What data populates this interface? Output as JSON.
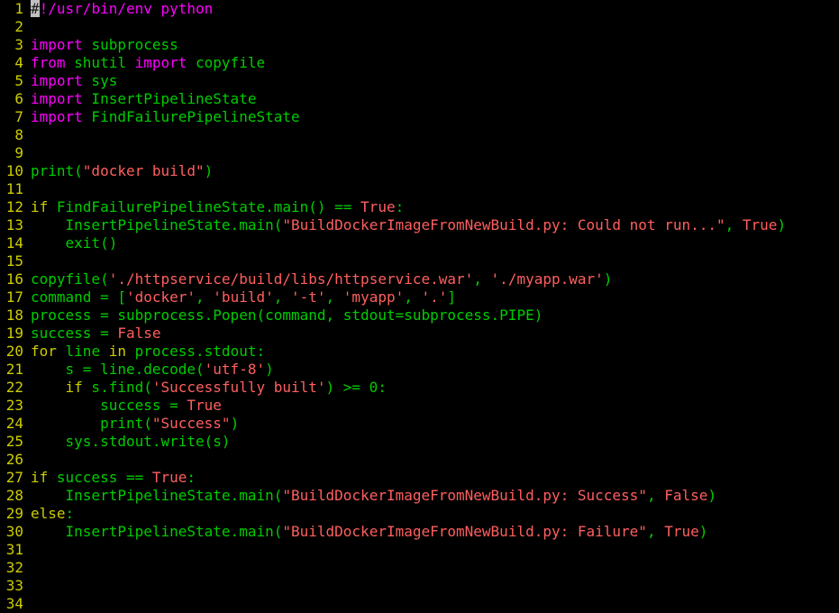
{
  "editor": {
    "filename": "BuildDockerImageFromNewBuild.py",
    "language": "python",
    "background_color": "#000000",
    "line_number_color": "#cdcd00",
    "total_lines": 34,
    "cursor": {
      "line": 1,
      "column": 1,
      "char": "#",
      "style": "block",
      "color": "#c0c0c0"
    },
    "colors": {
      "import_keyword": "#ff00ff",
      "control_keyword": "#cdcd00",
      "string": "#ff5f5f",
      "constant": "#ff5f5f",
      "identifier": "#00cd00"
    }
  },
  "lines": [
    {
      "n": "1",
      "tokens": [
        {
          "t": "#",
          "c": "comment",
          "cursor": true
        },
        {
          "t": "!/usr/bin/env python",
          "c": "comment"
        }
      ]
    },
    {
      "n": "2",
      "tokens": []
    },
    {
      "n": "3",
      "tokens": [
        {
          "t": "import",
          "c": "import"
        },
        {
          "t": " ",
          "c": "plain"
        },
        {
          "t": "subprocess",
          "c": "plain"
        }
      ]
    },
    {
      "n": "4",
      "tokens": [
        {
          "t": "from",
          "c": "import"
        },
        {
          "t": " shutil ",
          "c": "plain"
        },
        {
          "t": "import",
          "c": "import"
        },
        {
          "t": " copyfile",
          "c": "plain"
        }
      ]
    },
    {
      "n": "5",
      "tokens": [
        {
          "t": "import",
          "c": "import"
        },
        {
          "t": " sys",
          "c": "plain"
        }
      ]
    },
    {
      "n": "6",
      "tokens": [
        {
          "t": "import",
          "c": "import"
        },
        {
          "t": " InsertPipelineState",
          "c": "plain"
        }
      ]
    },
    {
      "n": "7",
      "tokens": [
        {
          "t": "import",
          "c": "import"
        },
        {
          "t": " FindFailurePipelineState",
          "c": "plain"
        }
      ]
    },
    {
      "n": "8",
      "tokens": []
    },
    {
      "n": "9",
      "tokens": []
    },
    {
      "n": "10",
      "tokens": [
        {
          "t": "print(",
          "c": "plain"
        },
        {
          "t": "\"docker build\"",
          "c": "string"
        },
        {
          "t": ")",
          "c": "plain"
        }
      ]
    },
    {
      "n": "11",
      "tokens": []
    },
    {
      "n": "12",
      "tokens": [
        {
          "t": "if",
          "c": "keyword"
        },
        {
          "t": " FindFailurePipelineState.main() == ",
          "c": "plain"
        },
        {
          "t": "True",
          "c": "const"
        },
        {
          "t": ":",
          "c": "plain"
        }
      ]
    },
    {
      "n": "13",
      "tokens": [
        {
          "t": "    InsertPipelineState.main(",
          "c": "plain"
        },
        {
          "t": "\"BuildDockerImageFromNewBuild.py: Could not run...\"",
          "c": "string"
        },
        {
          "t": ", ",
          "c": "plain"
        },
        {
          "t": "True",
          "c": "const"
        },
        {
          "t": ")",
          "c": "plain"
        }
      ]
    },
    {
      "n": "14",
      "tokens": [
        {
          "t": "    exit()",
          "c": "plain"
        }
      ]
    },
    {
      "n": "15",
      "tokens": []
    },
    {
      "n": "16",
      "tokens": [
        {
          "t": "copyfile(",
          "c": "plain"
        },
        {
          "t": "'./httpservice/build/libs/httpservice.war'",
          "c": "string"
        },
        {
          "t": ", ",
          "c": "plain"
        },
        {
          "t": "'./myapp.war'",
          "c": "string"
        },
        {
          "t": ")",
          "c": "plain"
        }
      ]
    },
    {
      "n": "17",
      "tokens": [
        {
          "t": "command = [",
          "c": "plain"
        },
        {
          "t": "'docker'",
          "c": "string"
        },
        {
          "t": ", ",
          "c": "plain"
        },
        {
          "t": "'build'",
          "c": "string"
        },
        {
          "t": ", ",
          "c": "plain"
        },
        {
          "t": "'-t'",
          "c": "string"
        },
        {
          "t": ", ",
          "c": "plain"
        },
        {
          "t": "'myapp'",
          "c": "string"
        },
        {
          "t": ", ",
          "c": "plain"
        },
        {
          "t": "'.'",
          "c": "string"
        },
        {
          "t": "]",
          "c": "plain"
        }
      ]
    },
    {
      "n": "18",
      "tokens": [
        {
          "t": "process = subprocess.Popen(command, stdout=subprocess.PIPE)",
          "c": "plain"
        }
      ]
    },
    {
      "n": "19",
      "tokens": [
        {
          "t": "success = ",
          "c": "plain"
        },
        {
          "t": "False",
          "c": "const"
        }
      ]
    },
    {
      "n": "20",
      "tokens": [
        {
          "t": "for",
          "c": "keyword"
        },
        {
          "t": " line ",
          "c": "plain"
        },
        {
          "t": "in",
          "c": "keyword"
        },
        {
          "t": " process.stdout:",
          "c": "plain"
        }
      ]
    },
    {
      "n": "21",
      "tokens": [
        {
          "t": "    s = line.decode(",
          "c": "plain"
        },
        {
          "t": "'utf-8'",
          "c": "string"
        },
        {
          "t": ")",
          "c": "plain"
        }
      ]
    },
    {
      "n": "22",
      "tokens": [
        {
          "t": "    ",
          "c": "plain"
        },
        {
          "t": "if",
          "c": "keyword"
        },
        {
          "t": " s.find(",
          "c": "plain"
        },
        {
          "t": "'Successfully built'",
          "c": "string"
        },
        {
          "t": ") >= 0:",
          "c": "plain"
        }
      ]
    },
    {
      "n": "23",
      "tokens": [
        {
          "t": "        success = ",
          "c": "plain"
        },
        {
          "t": "True",
          "c": "const"
        }
      ]
    },
    {
      "n": "24",
      "tokens": [
        {
          "t": "        print(",
          "c": "plain"
        },
        {
          "t": "\"Success\"",
          "c": "string"
        },
        {
          "t": ")",
          "c": "plain"
        }
      ]
    },
    {
      "n": "25",
      "tokens": [
        {
          "t": "    sys.stdout.write(s)",
          "c": "plain"
        }
      ]
    },
    {
      "n": "26",
      "tokens": []
    },
    {
      "n": "27",
      "tokens": [
        {
          "t": "if",
          "c": "keyword"
        },
        {
          "t": " success == ",
          "c": "plain"
        },
        {
          "t": "True",
          "c": "const"
        },
        {
          "t": ":",
          "c": "plain"
        }
      ]
    },
    {
      "n": "28",
      "tokens": [
        {
          "t": "    InsertPipelineState.main(",
          "c": "plain"
        },
        {
          "t": "\"BuildDockerImageFromNewBuild.py: Success\"",
          "c": "string"
        },
        {
          "t": ", ",
          "c": "plain"
        },
        {
          "t": "False",
          "c": "const"
        },
        {
          "t": ")",
          "c": "plain"
        }
      ]
    },
    {
      "n": "29",
      "tokens": [
        {
          "t": "else",
          "c": "keyword"
        },
        {
          "t": ":",
          "c": "plain"
        }
      ]
    },
    {
      "n": "30",
      "tokens": [
        {
          "t": "    InsertPipelineState.main(",
          "c": "plain"
        },
        {
          "t": "\"BuildDockerImageFromNewBuild.py: Failure\"",
          "c": "string"
        },
        {
          "t": ", ",
          "c": "plain"
        },
        {
          "t": "True",
          "c": "const"
        },
        {
          "t": ")",
          "c": "plain"
        }
      ]
    },
    {
      "n": "31",
      "tokens": []
    },
    {
      "n": "32",
      "tokens": []
    },
    {
      "n": "33",
      "tokens": []
    },
    {
      "n": "34",
      "tokens": []
    }
  ]
}
